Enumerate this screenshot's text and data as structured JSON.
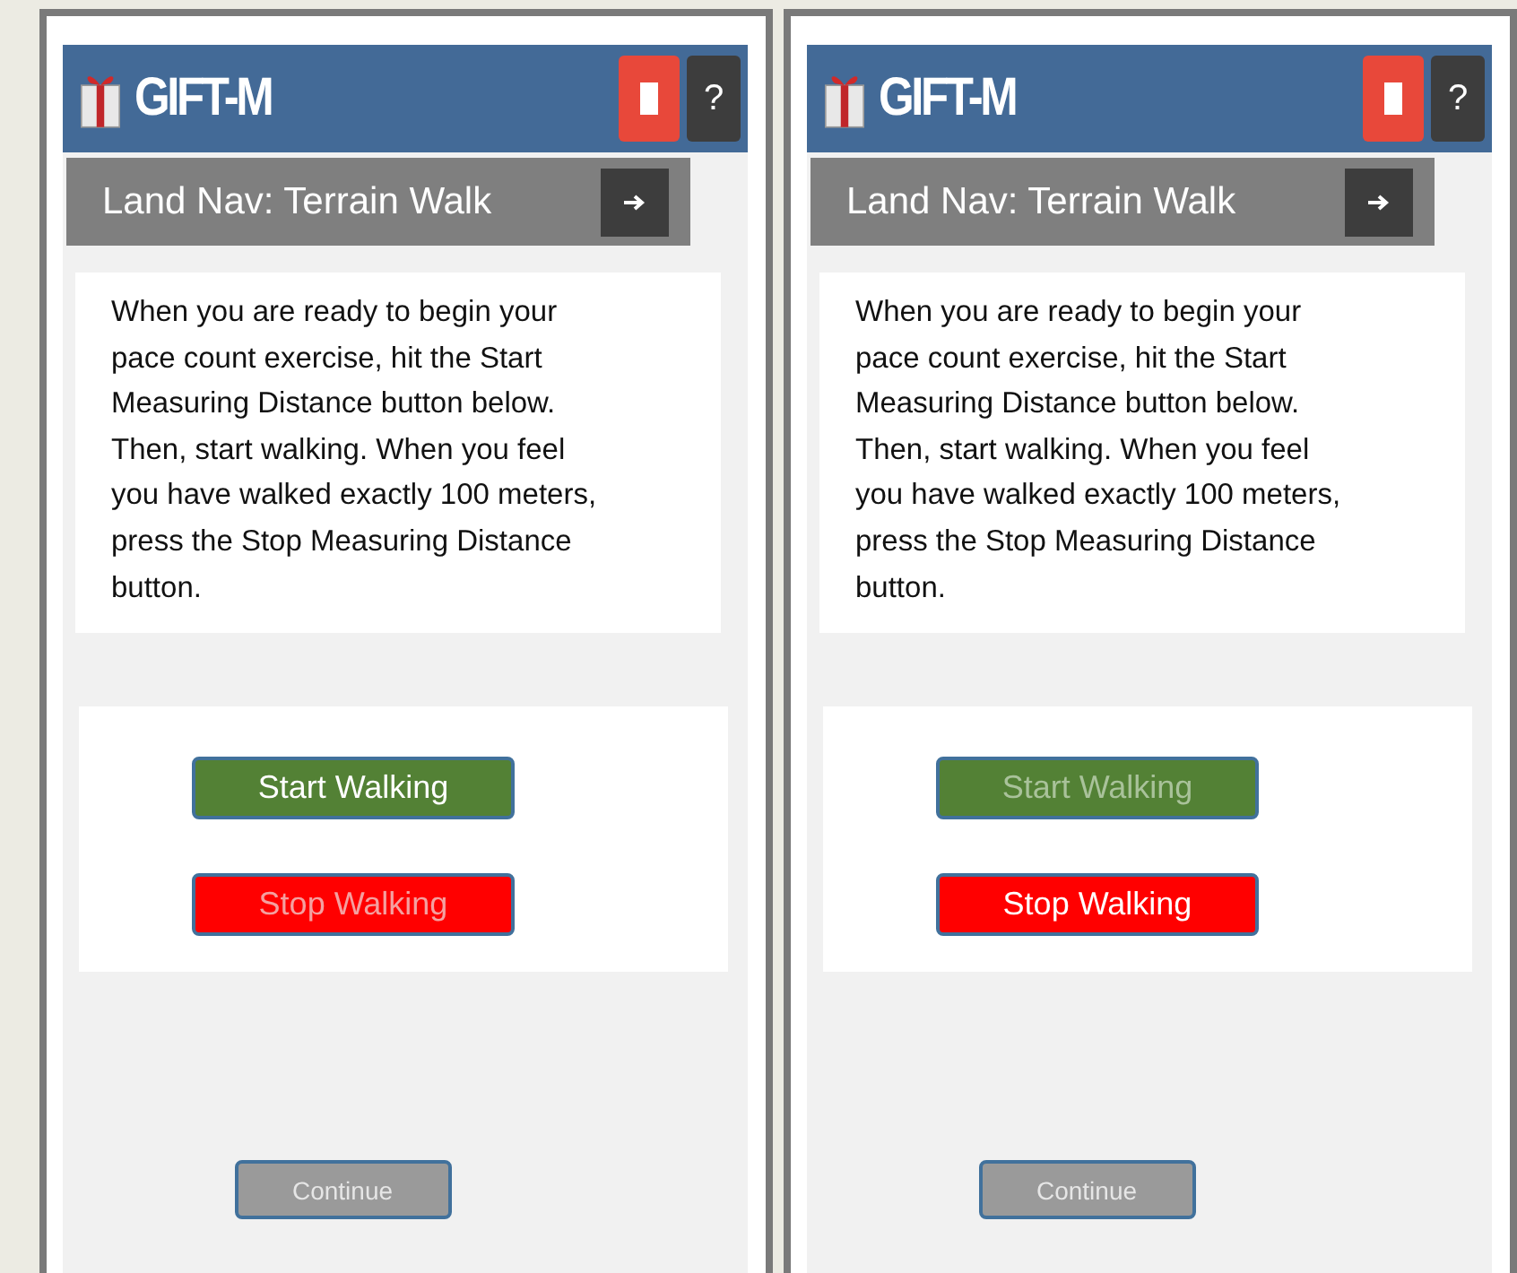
{
  "screens": [
    {
      "app_title": "GIFT-M",
      "help_label": "?",
      "heading": "Land Nav: Terrain Walk",
      "instructions": "When you are ready to begin your\npace count exercise, hit the Start\nMeasuring Distance button below.\nThen, start walking. When you feel\nyou have walked exactly 100 meters,\npress the Stop Measuring Distance\nbutton.",
      "buttons": [
        {
          "kind": "start",
          "label": "Start Walking",
          "disabled": false
        },
        {
          "kind": "stop",
          "label": "Stop Walking",
          "disabled": true
        }
      ],
      "continue": {
        "label": "Continue",
        "disabled": true
      }
    },
    {
      "app_title": "GIFT-M",
      "help_label": "?",
      "heading": "Land Nav: Terrain Walk",
      "instructions": "When you are ready to begin your\npace count exercise, hit the Start\nMeasuring Distance button below.\nThen, start walking. When you feel\nyou have walked exactly 100 meters,\npress the Stop Measuring Distance\nbutton.",
      "buttons": [
        {
          "kind": "start",
          "label": "Start Walking",
          "disabled": true
        },
        {
          "kind": "stop",
          "label": "Stop Walking",
          "disabled": false
        }
      ],
      "continue": {
        "label": "Continue",
        "disabled": true
      }
    }
  ]
}
